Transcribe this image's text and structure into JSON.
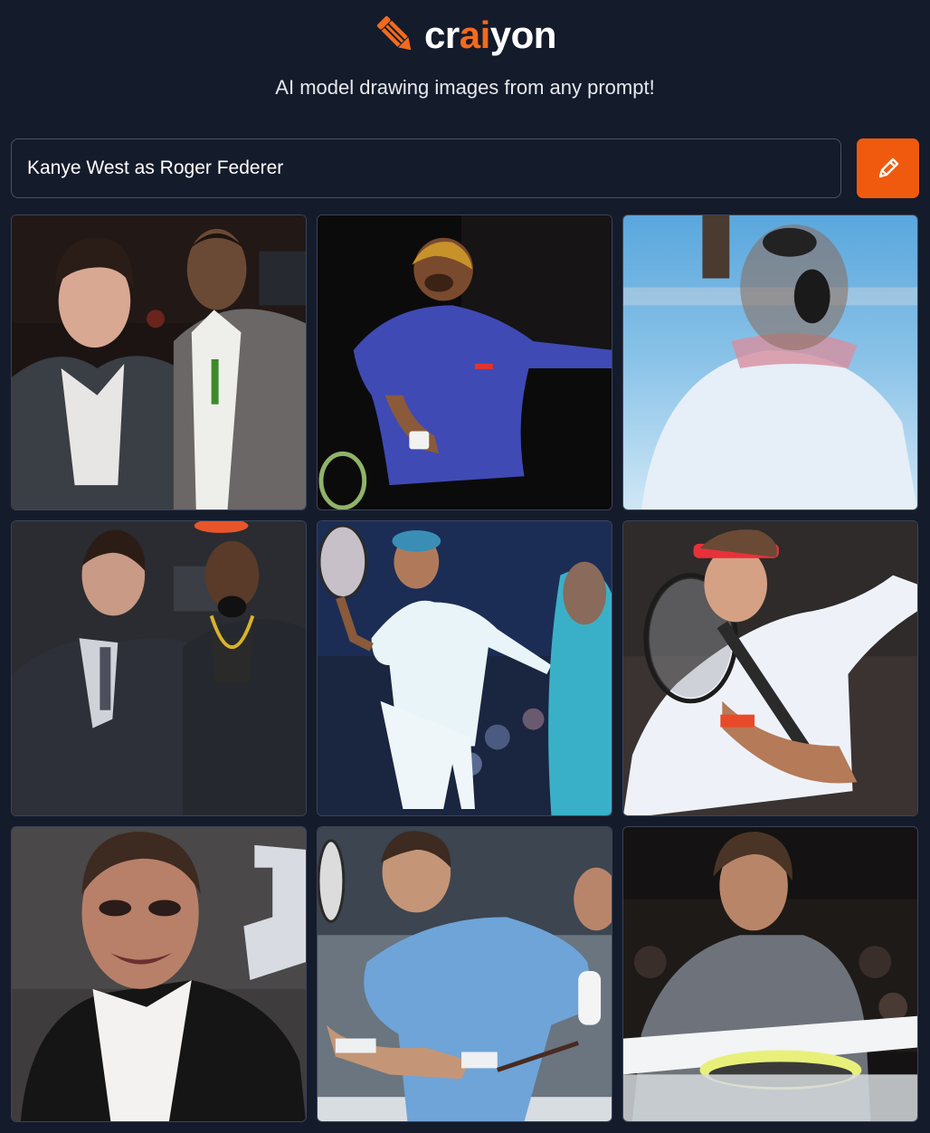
{
  "header": {
    "logo_prefix": "cr",
    "logo_accent": "ai",
    "logo_suffix": "yon",
    "tagline": "AI model drawing images from any prompt!"
  },
  "prompt": {
    "value": "Kanye West as Roger Federer"
  },
  "colors": {
    "background": "#141b2b",
    "accent": "#f05a0f",
    "logo_accent": "#f26b1d",
    "border": "#4a5265"
  },
  "icons": {
    "logo": "pencil-icon",
    "draw_button": "pencil-icon"
  },
  "images": [
    {
      "description": "two men in dark suits at an event"
    },
    {
      "description": "man in blue polo swinging tennis racket"
    },
    {
      "description": "blurry face over tennis court in light blue shirt"
    },
    {
      "description": "two men in suits, one with gold chain"
    },
    {
      "description": "tennis player in white with racket and headband"
    },
    {
      "description": "tennis player in white shirt with red headband"
    },
    {
      "description": "smiling man in black suit and white shirt"
    },
    {
      "description": "tennis player in light blue shirt swinging"
    },
    {
      "description": "man in grey shirt holding tennis ball display"
    }
  ]
}
